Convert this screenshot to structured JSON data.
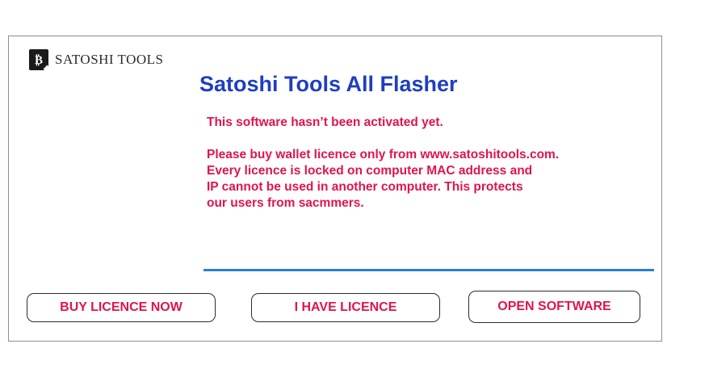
{
  "logo": {
    "mark": "₿",
    "text": "SATOSHI TOOLS"
  },
  "title": "Satoshi Tools All Flasher",
  "message": {
    "status": "This software hasn’t been activated yet.",
    "lines": [
      "Please buy wallet licence only from www.satoshitools.com.",
      "Every licence is locked on computer MAC address  and",
      "IP cannot be used in another computer. This protects",
      "our users from sacmmers."
    ]
  },
  "licence_input": {
    "value": "",
    "placeholder": ""
  },
  "buttons": {
    "buy": "BUY LICENCE NOW",
    "have": "I HAVE LICENCE",
    "open": "OPEN SOFTWARE"
  },
  "colors": {
    "title": "#1f3fbf",
    "message": "#e0144f",
    "input_underline": "#2a7fd0",
    "window_border": "#8e8e8e"
  }
}
